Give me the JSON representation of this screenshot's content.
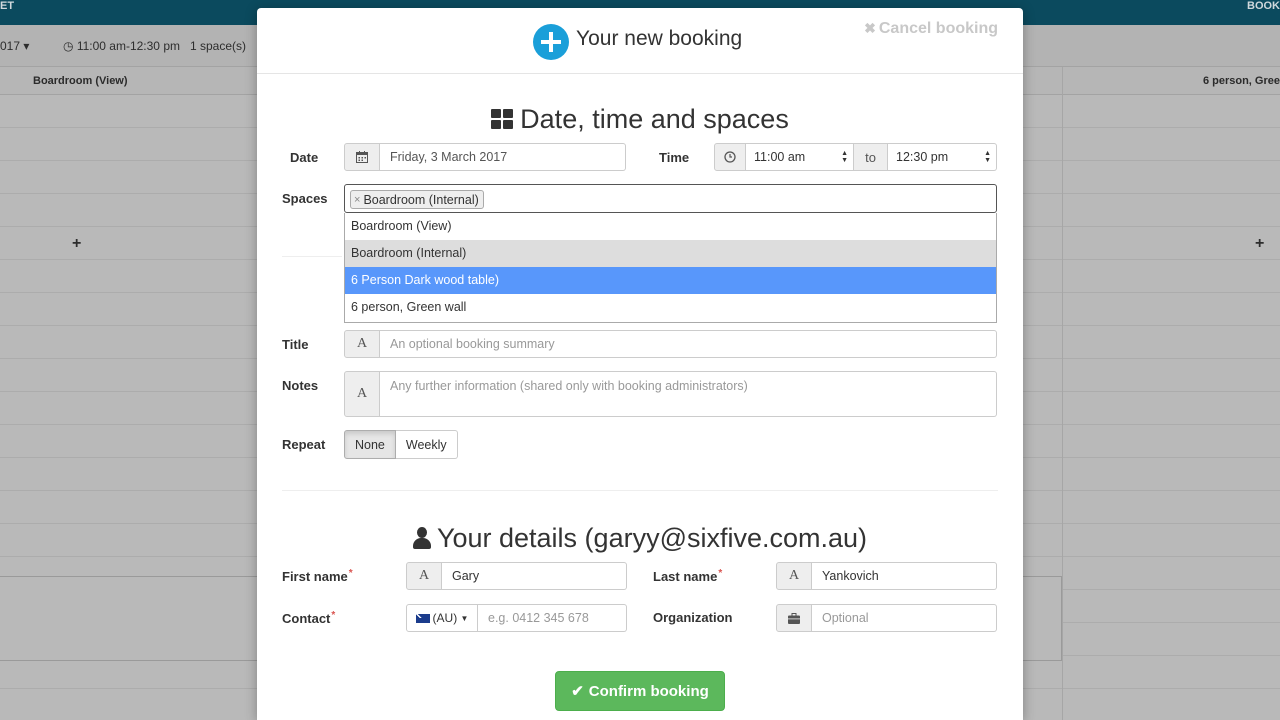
{
  "background": {
    "topbar_left": "ET",
    "topbar_right": "BOOK",
    "year_label": "017",
    "toolbar_time": "11:00 am-12:30 pm",
    "toolbar_spaces": "1 space(s)",
    "col_left": "Boardroom (View)",
    "col_right": "6 person, Gree"
  },
  "modal": {
    "title": "Your new booking",
    "cancel_label": "Cancel booking"
  },
  "datetime": {
    "heading": "Date, time and spaces",
    "date_label": "Date",
    "date_value": "Friday, 3 March 2017",
    "time_label": "Time",
    "time_start": "11:00 am",
    "to_label": "to",
    "time_end": "12:30 pm",
    "spaces_label": "Spaces",
    "selected_tag": "Boardroom (Internal)",
    "options": [
      "Boardroom (View)",
      "Boardroom (Internal)",
      "6 Person Dark wood table)",
      "6 person, Green wall"
    ],
    "title_label": "Title",
    "title_placeholder": "An optional booking summary",
    "notes_label": "Notes",
    "notes_placeholder": "Any further information (shared only with booking administrators)",
    "repeat_label": "Repeat",
    "repeat_none": "None",
    "repeat_weekly": "Weekly"
  },
  "details": {
    "heading": "Your details (garyy@sixfive.com.au)",
    "first_name_label": "First name",
    "first_name_value": "Gary",
    "last_name_label": "Last name",
    "last_name_value": "Yankovich",
    "contact_label": "Contact",
    "country_code": "(AU)",
    "phone_placeholder": "e.g. 0412 345 678",
    "organization_label": "Organization",
    "organization_placeholder": "Optional"
  },
  "confirm_label": "Confirm booking",
  "colors": {
    "accent": "#1a9fd9",
    "highlight": "#5897fb",
    "confirm": "#5cb85c"
  }
}
